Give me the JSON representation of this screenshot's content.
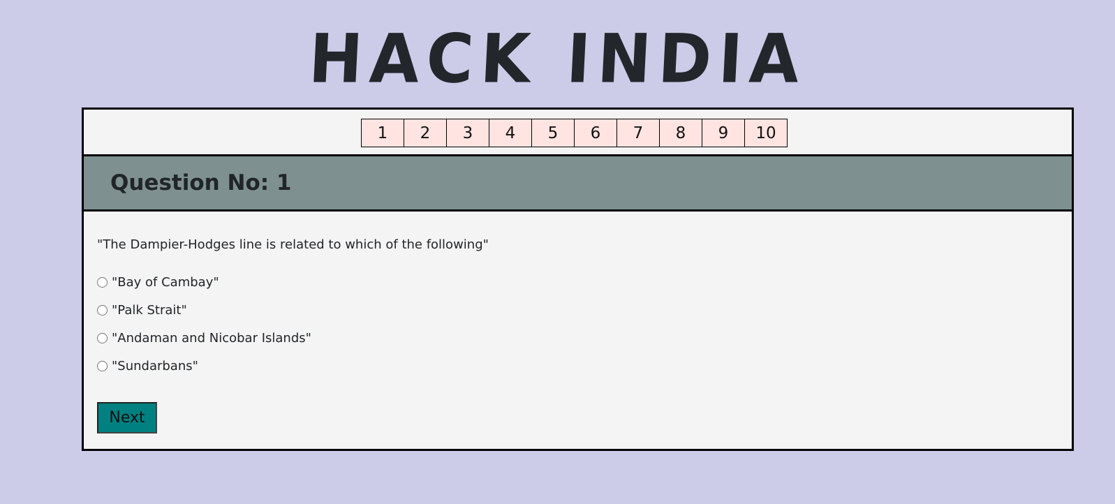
{
  "site": {
    "title": "HACK INDIA"
  },
  "nav": {
    "buttons": [
      "1",
      "2",
      "3",
      "4",
      "5",
      "6",
      "7",
      "8",
      "9",
      "10"
    ]
  },
  "question": {
    "header": "Question No: 1",
    "text": "\"The Dampier-Hodges line is related to which of the following\"",
    "options": [
      "\"Bay of Cambay\"",
      "\"Palk Strait\"",
      "\"Andaman and Nicobar Islands\"",
      "\"Sundarbans\""
    ]
  },
  "actions": {
    "next_label": "Next"
  },
  "colors": {
    "page_background": "#cccbe8",
    "card_background": "#f4f4f4",
    "nav_button": "#ffe4e1",
    "header_background": "#7e9190",
    "next_button": "#008080"
  }
}
